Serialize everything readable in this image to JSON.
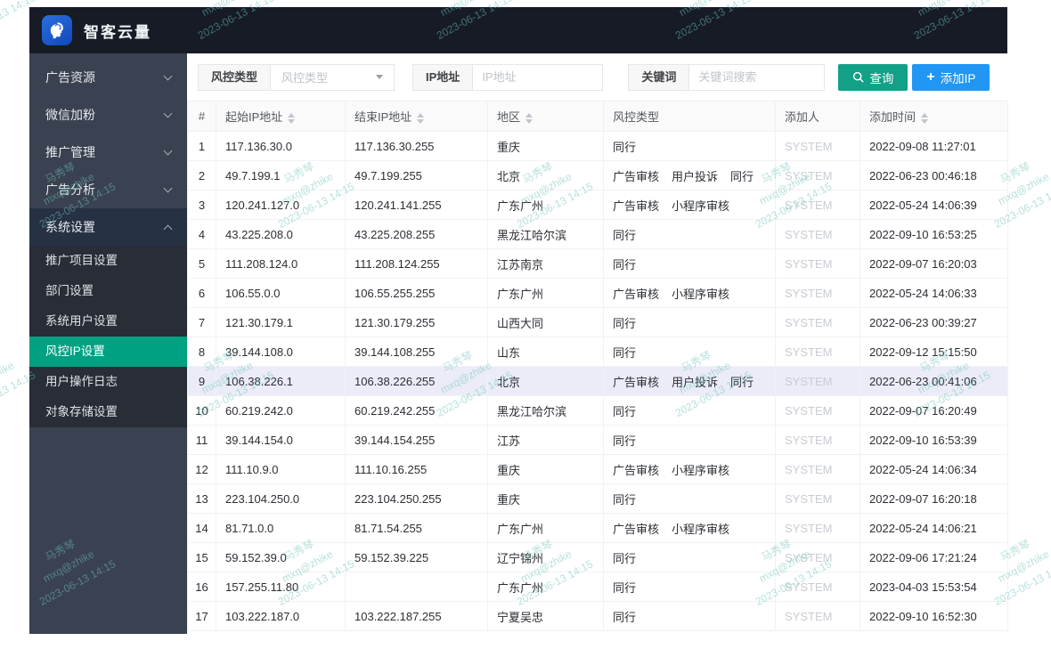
{
  "app": {
    "title": "智客云量"
  },
  "watermark": {
    "line1": "马秀琴",
    "line2": "mxq@zhike",
    "line3": "2023-06-13 14:15"
  },
  "colors": {
    "accent_teal": "#00a183",
    "search_button_green": "#12a087",
    "add_button_blue": "#2196f3",
    "highlight_row": "#ebecf7",
    "watermark": "#6fc4bc",
    "topbar_dark": "#161b25",
    "sidebar_dark": "#3a4150"
  },
  "sidebar": {
    "items": [
      {
        "label": "广告资源",
        "state": "collapsed"
      },
      {
        "label": "微信加粉",
        "state": "collapsed"
      },
      {
        "label": "推广管理",
        "state": "collapsed"
      },
      {
        "label": "广告分析",
        "state": "collapsed"
      },
      {
        "label": "系统设置",
        "state": "expanded"
      }
    ],
    "submenu": [
      {
        "label": "推广项目设置",
        "active": false
      },
      {
        "label": "部门设置",
        "active": false
      },
      {
        "label": "系统用户设置",
        "active": false
      },
      {
        "label": "风控IP设置",
        "active": true
      },
      {
        "label": "用户操作日志",
        "active": false
      },
      {
        "label": "对象存储设置",
        "active": false
      }
    ]
  },
  "filters": {
    "risk_type_label": "风控类型",
    "risk_type_placeholder": "风控类型",
    "ip_label": "IP地址",
    "ip_placeholder": "IP地址",
    "ip_value": "",
    "keyword_label": "关键词",
    "keyword_placeholder": "关键词搜索",
    "keyword_value": "",
    "search_button": "查询",
    "add_button": "添加IP"
  },
  "table": {
    "columns": [
      {
        "key": "no",
        "label": "#",
        "sortable": false,
        "align": "center"
      },
      {
        "key": "start_ip",
        "label": "起始IP地址",
        "sortable": true
      },
      {
        "key": "end_ip",
        "label": "结束IP地址",
        "sortable": true
      },
      {
        "key": "region",
        "label": "地区",
        "sortable": true
      },
      {
        "key": "risk_types",
        "label": "风控类型",
        "sortable": false
      },
      {
        "key": "added_by",
        "label": "添加人",
        "sortable": false
      },
      {
        "key": "added_at",
        "label": "添加时间",
        "sortable": true
      }
    ],
    "rows": [
      {
        "no": "1",
        "start_ip": "117.136.30.0",
        "end_ip": "117.136.30.255",
        "region": "重庆",
        "risk_types": [
          "同行"
        ],
        "added_by": "SYSTEM",
        "added_at": "2022-09-08 11:27:01",
        "highlighted": false
      },
      {
        "no": "2",
        "start_ip": "49.7.199.1",
        "end_ip": "49.7.199.255",
        "region": "北京",
        "risk_types": [
          "广告审核",
          "用户投诉",
          "同行"
        ],
        "added_by": "SYSTEM",
        "added_at": "2022-06-23 00:46:18",
        "highlighted": false
      },
      {
        "no": "3",
        "start_ip": "120.241.127.0",
        "end_ip": "120.241.141.255",
        "region": "广东广州",
        "risk_types": [
          "广告审核",
          "小程序审核"
        ],
        "added_by": "SYSTEM",
        "added_at": "2022-05-24 14:06:39",
        "highlighted": false
      },
      {
        "no": "4",
        "start_ip": "43.225.208.0",
        "end_ip": "43.225.208.255",
        "region": "黑龙江哈尔滨",
        "risk_types": [
          "同行"
        ],
        "added_by": "SYSTEM",
        "added_at": "2022-09-10 16:53:25",
        "highlighted": false
      },
      {
        "no": "5",
        "start_ip": "111.208.124.0",
        "end_ip": "111.208.124.255",
        "region": "江苏南京",
        "risk_types": [
          "同行"
        ],
        "added_by": "SYSTEM",
        "added_at": "2022-09-07 16:20:03",
        "highlighted": false
      },
      {
        "no": "6",
        "start_ip": "106.55.0.0",
        "end_ip": "106.55.255.255",
        "region": "广东广州",
        "risk_types": [
          "广告审核",
          "小程序审核"
        ],
        "added_by": "SYSTEM",
        "added_at": "2022-05-24 14:06:33",
        "highlighted": false
      },
      {
        "no": "7",
        "start_ip": "121.30.179.1",
        "end_ip": "121.30.179.255",
        "region": "山西大同",
        "risk_types": [
          "同行"
        ],
        "added_by": "SYSTEM",
        "added_at": "2022-06-23 00:39:27",
        "highlighted": false
      },
      {
        "no": "8",
        "start_ip": "39.144.108.0",
        "end_ip": "39.144.108.255",
        "region": "山东",
        "risk_types": [
          "同行"
        ],
        "added_by": "SYSTEM",
        "added_at": "2022-09-12 15:15:50",
        "highlighted": false
      },
      {
        "no": "9",
        "start_ip": "106.38.226.1",
        "end_ip": "106.38.226.255",
        "region": "北京",
        "risk_types": [
          "广告审核",
          "用户投诉",
          "同行"
        ],
        "added_by": "SYSTEM",
        "added_at": "2022-06-23 00:41:06",
        "highlighted": true
      },
      {
        "no": "10",
        "start_ip": "60.219.242.0",
        "end_ip": "60.219.242.255",
        "region": "黑龙江哈尔滨",
        "risk_types": [
          "同行"
        ],
        "added_by": "SYSTEM",
        "added_at": "2022-09-07 16:20:49",
        "highlighted": false
      },
      {
        "no": "11",
        "start_ip": "39.144.154.0",
        "end_ip": "39.144.154.255",
        "region": "江苏",
        "risk_types": [
          "同行"
        ],
        "added_by": "SYSTEM",
        "added_at": "2022-09-10 16:53:39",
        "highlighted": false
      },
      {
        "no": "12",
        "start_ip": "111.10.9.0",
        "end_ip": "111.10.16.255",
        "region": "重庆",
        "risk_types": [
          "广告审核",
          "小程序审核"
        ],
        "added_by": "SYSTEM",
        "added_at": "2022-05-24 14:06:34",
        "highlighted": false
      },
      {
        "no": "13",
        "start_ip": "223.104.250.0",
        "end_ip": "223.104.250.255",
        "region": "重庆",
        "risk_types": [
          "同行"
        ],
        "added_by": "SYSTEM",
        "added_at": "2022-09-07 16:20:18",
        "highlighted": false
      },
      {
        "no": "14",
        "start_ip": "81.71.0.0",
        "end_ip": "81.71.54.255",
        "region": "广东广州",
        "risk_types": [
          "广告审核",
          "小程序审核"
        ],
        "added_by": "SYSTEM",
        "added_at": "2022-05-24 14:06:21",
        "highlighted": false
      },
      {
        "no": "15",
        "start_ip": "59.152.39.0",
        "end_ip": "59.152.39.225",
        "region": "辽宁锦州",
        "risk_types": [
          "同行"
        ],
        "added_by": "SYSTEM",
        "added_at": "2022-09-06 17:21:24",
        "highlighted": false
      },
      {
        "no": "16",
        "start_ip": "157.255.11.80",
        "end_ip": "",
        "region": "广东广州",
        "risk_types": [
          "同行"
        ],
        "added_by": "SYSTEM",
        "added_at": "2023-04-03 15:53:54",
        "highlighted": false
      },
      {
        "no": "17",
        "start_ip": "103.222.187.0",
        "end_ip": "103.222.187.255",
        "region": "宁夏吴忠",
        "risk_types": [
          "同行"
        ],
        "added_by": "SYSTEM",
        "added_at": "2022-09-10 16:52:30",
        "highlighted": false
      }
    ]
  }
}
